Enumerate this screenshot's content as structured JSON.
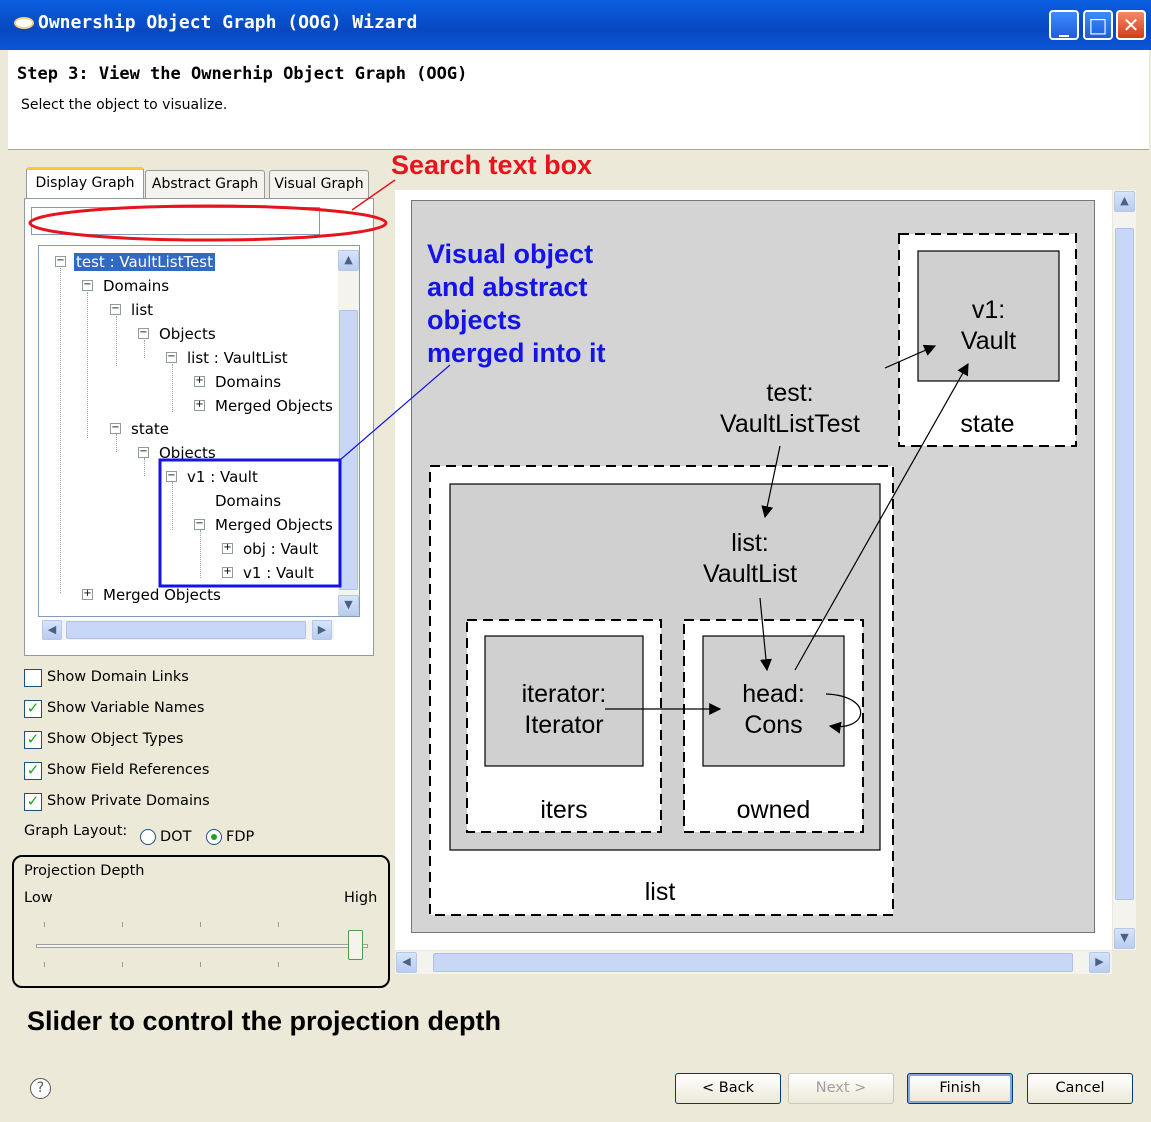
{
  "window": {
    "title": "Ownership Object Graph (OOG) Wizard",
    "minimize": "_",
    "maximize": "□",
    "close": "✕"
  },
  "header": {
    "step": "Step 3: View the Ownerhip Object Graph (OOG)",
    "subtitle": "Select the object to visualize."
  },
  "tabs": [
    {
      "label": "Display Graph",
      "active": true
    },
    {
      "label": "Abstract Graph",
      "active": false
    },
    {
      "label": "Visual Graph",
      "active": false
    }
  ],
  "search": {
    "value": "",
    "placeholder": ""
  },
  "tree": {
    "items": [
      {
        "label": "test : VaultListTest",
        "expander": "−",
        "selected": true
      },
      {
        "label": "Domains",
        "expander": "−"
      },
      {
        "label": "list",
        "expander": "−"
      },
      {
        "label": "Objects",
        "expander": "−"
      },
      {
        "label": "list : VaultList",
        "expander": "−"
      },
      {
        "label": "Domains",
        "expander": "+"
      },
      {
        "label": "Merged Objects",
        "expander": "+"
      },
      {
        "label": "state",
        "expander": "−"
      },
      {
        "label": "Objects",
        "expander": "−"
      },
      {
        "label": "v1 : Vault",
        "expander": "−"
      },
      {
        "label": "Domains",
        "expander": ""
      },
      {
        "label": "Merged Objects",
        "expander": "−"
      },
      {
        "label": "obj : Vault",
        "expander": "+"
      },
      {
        "label": "v1 : Vault",
        "expander": "+"
      },
      {
        "label": "Merged Objects",
        "expander": "+"
      }
    ]
  },
  "options": {
    "show_domain_links": {
      "label": "Show Domain Links",
      "checked": false
    },
    "show_variable_names": {
      "label": "Show Variable Names",
      "checked": true
    },
    "show_object_types": {
      "label": "Show Object Types",
      "checked": true
    },
    "show_field_references": {
      "label": "Show Field References",
      "checked": true
    },
    "show_private_domains": {
      "label": "Show Private Domains",
      "checked": true
    },
    "graph_layout": {
      "label": "Graph Layout:",
      "options": [
        "DOT",
        "FDP"
      ],
      "selected": "FDP"
    }
  },
  "projection": {
    "title": "Projection Depth",
    "low": "Low",
    "high": "High",
    "value": 1.0
  },
  "graph": {
    "nodes": {
      "v1": "v1:\nVault",
      "test": "test:\nVaultListTest",
      "list_obj": "list:\nVaultList",
      "iterator": "iterator:\nIterator",
      "head": "head:\nCons"
    },
    "domains": {
      "state": "state",
      "list": "list",
      "iters": "iters",
      "owned": "owned"
    }
  },
  "annotations": {
    "search": "Search text box",
    "merged": "Visual object\nand abstract\nobjects\nmerged into it",
    "slider": "Slider to control the projection depth"
  },
  "buttons": {
    "help": "?",
    "back": "< Back",
    "next": "Next >",
    "finish": "Finish",
    "cancel": "Cancel"
  },
  "colors": {
    "title_bar": "#0a56d8",
    "annotation_red": "#e8141d",
    "annotation_blue": "#1414e6",
    "selection": "#316ac5"
  }
}
